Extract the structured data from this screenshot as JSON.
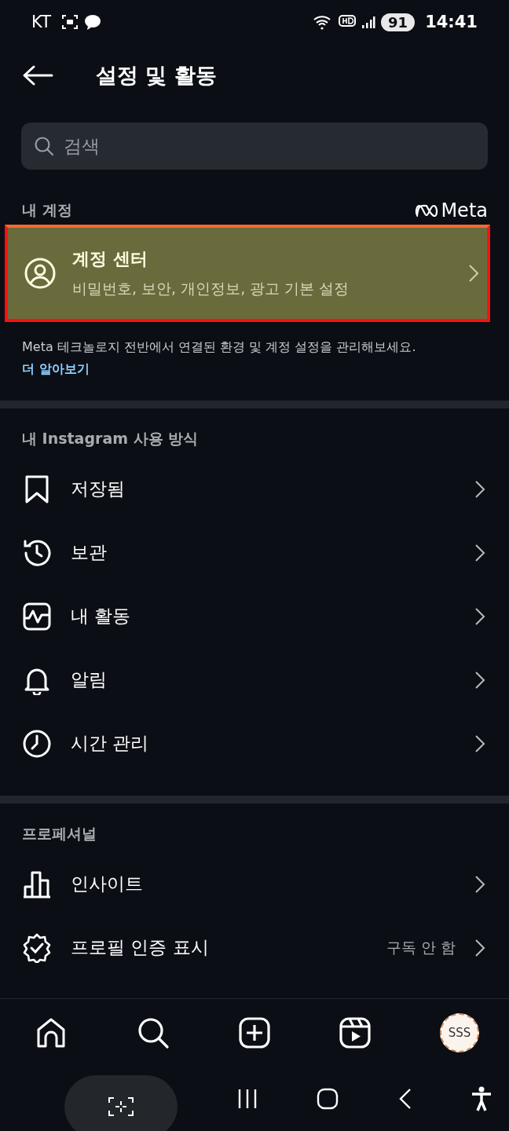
{
  "status_bar": {
    "carrier": "KT",
    "battery": "91",
    "time": "14:41"
  },
  "header": {
    "title": "설정 및 활동"
  },
  "search": {
    "placeholder": "검색"
  },
  "account_section": {
    "label": "내 계정",
    "brand": "Meta",
    "account_center": {
      "title": "계정 센터",
      "subtitle": "비밀번호, 보안, 개인정보, 광고 기본 설정",
      "highlighted": true
    },
    "description": "Meta 테크놀로지 전반에서 연결된 환경 및 계정 설정을 관리해보세요.",
    "link": "더 알아보기"
  },
  "sections": [
    {
      "label": "내 Instagram 사용 방식",
      "items": [
        {
          "label": "저장됨"
        },
        {
          "label": "보관"
        },
        {
          "label": "내 활동"
        },
        {
          "label": "알림"
        },
        {
          "label": "시간 관리"
        }
      ]
    },
    {
      "label": "프로페셔널",
      "items": [
        {
          "label": "인사이트"
        },
        {
          "label": "프로필 인증 표시",
          "value": "구독 안 함"
        }
      ]
    }
  ],
  "bottom_nav": {
    "avatar": "SSS"
  }
}
